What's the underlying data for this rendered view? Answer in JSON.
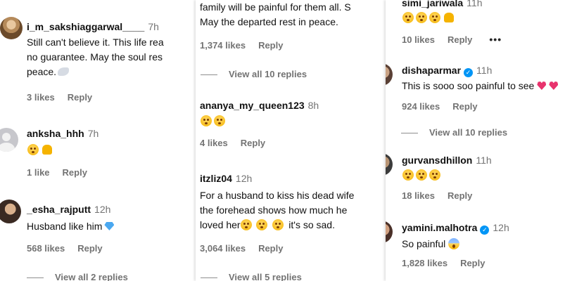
{
  "left": {
    "comments": [
      {
        "username": "i_m_sakshiaggarwal____",
        "time": "7h",
        "lines": [
          "Still can't believe it. This life rea",
          "no guarantee. May the soul res",
          "peace."
        ],
        "likes": "3 likes",
        "reply": "Reply"
      },
      {
        "username": "anksha_hhh",
        "time": "7h",
        "likes": "1 like",
        "reply": "Reply"
      },
      {
        "username": "_esha_rajputt",
        "time": "12h",
        "text": "Husband like him",
        "likes": "568 likes",
        "reply": "Reply"
      }
    ],
    "view_replies": "View all 2 replies"
  },
  "middle": {
    "top_lines": [
      "family will be painful for them all. S",
      "May the departed rest in peace."
    ],
    "top_likes": "1,374 likes",
    "top_reply": "Reply",
    "view_replies_top": "View all 10 replies",
    "comments": [
      {
        "username": "ananya_my_queen123",
        "time": "8h",
        "likes": "4 likes",
        "reply": "Reply"
      },
      {
        "username": "itzliz04",
        "time": "12h",
        "lines": [
          "For a husband to kiss his dead wife",
          "the forehead shows how much he",
          "loved her"
        ],
        "tail": "it's so sad.",
        "likes": "3,064 likes",
        "reply": "Reply"
      }
    ],
    "view_replies_bottom": "View all 5 replies"
  },
  "right": {
    "comments": [
      {
        "username": "simi_jariwala",
        "time": "11h",
        "likes": "10 likes",
        "reply": "Reply",
        "more": "•••"
      },
      {
        "username": "dishaparmar",
        "time": "11h",
        "verified": true,
        "text": "This is sooo soo painful to see",
        "likes": "924 likes",
        "reply": "Reply"
      },
      {
        "username": "gurvansdhillon",
        "time": "11h",
        "likes": "18 likes",
        "reply": "Reply"
      },
      {
        "username": "yamini.malhotra",
        "time": "12h",
        "verified": true,
        "text": "So painful",
        "likes": "1,828 likes",
        "reply": "Reply"
      }
    ],
    "view_replies": "View all 10 replies"
  },
  "colors": {
    "text": "#111111",
    "muted": "#737373",
    "verified": "#0095f6",
    "heart": "#e8336d"
  }
}
